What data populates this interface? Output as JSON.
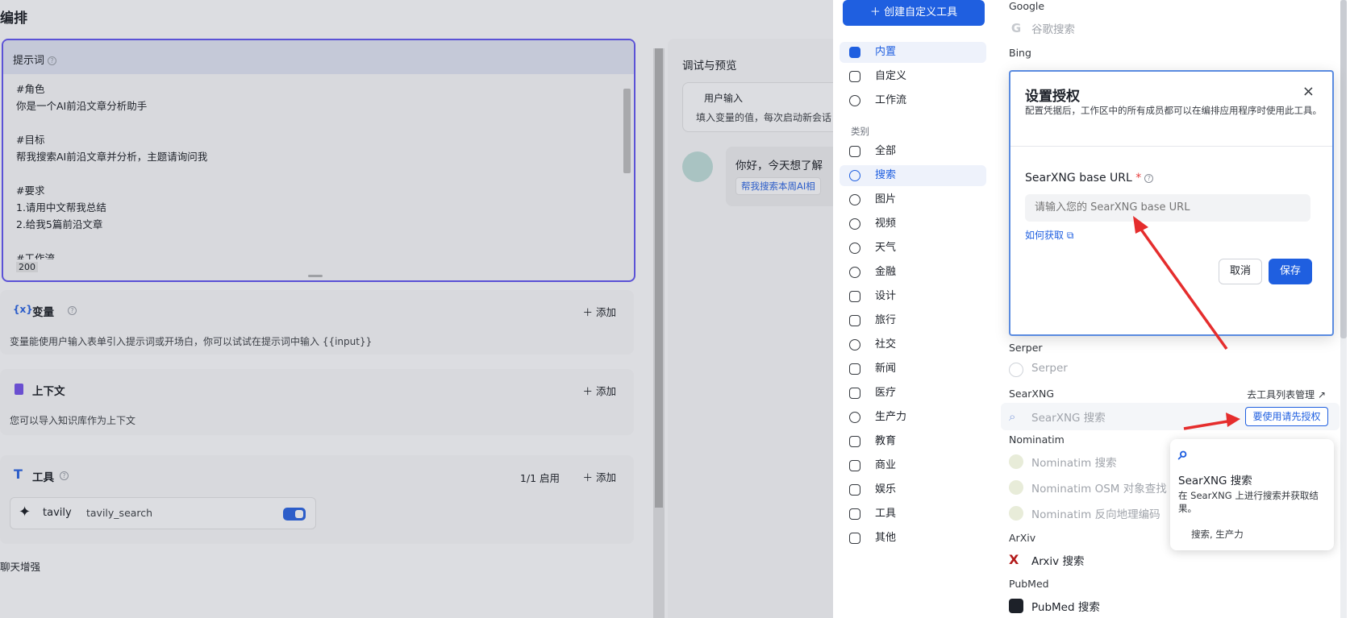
{
  "editor": {
    "title": "编排",
    "prompt": {
      "label": "提示词",
      "text": "#角色\n你是一个AI前沿文章分析助手\n\n#目标\n帮我搜索AI前沿文章并分析，主题请询问我\n\n#要求\n1.请用中文帮我总结\n2.给我5篇前沿文章\n\n#工作流",
      "count": "200"
    },
    "variables": {
      "title": "变量",
      "add": "添加",
      "desc": "变量能使用户输入表单引入提示词或开场白，你可以试试在提示词中输入 {{input}}"
    },
    "context": {
      "title": "上下文",
      "add": "添加",
      "desc": "您可以导入知识库作为上下文"
    },
    "tools": {
      "title": "工具",
      "status": "1/1 启用",
      "add": "添加",
      "item_name": "tavily",
      "item_tool": "tavily_search"
    },
    "chat_enhance": "聊天增强"
  },
  "debug": {
    "title": "调试与预览",
    "user_input": "用户输入",
    "user_input_desc": "填入变量的值，每次启动新会话",
    "greeting": "你好，今天想了解",
    "suggestion": "帮我搜索本周AI相"
  },
  "selector": {
    "create_button": "创建自定义工具",
    "nav": [
      "内置",
      "自定义",
      "工作流"
    ],
    "category_label": "类别",
    "categories": [
      "全部",
      "搜索",
      "图片",
      "视频",
      "天气",
      "金融",
      "设计",
      "旅行",
      "社交",
      "新闻",
      "医疗",
      "生产力",
      "教育",
      "商业",
      "娱乐",
      "工具",
      "其他"
    ],
    "active_nav": "内置",
    "active_category": "搜索"
  },
  "toollist": {
    "google": {
      "provider": "Google",
      "tool": "谷歌搜索"
    },
    "bing": {
      "provider": "Bing"
    },
    "serper": {
      "provider": "Serper",
      "tool": "Serper"
    },
    "searxng": {
      "provider": "SearXNG",
      "tool": "SearXNG 搜索",
      "manage": "去工具列表管理 ↗",
      "auth_button": "要使用请先授权"
    },
    "nominatim": {
      "provider": "Nominatim",
      "tools": [
        "Nominatim 搜索",
        "Nominatim OSM 对象查找",
        "Nominatim 反向地理编码"
      ]
    },
    "arxiv": {
      "provider": "ArXiv",
      "tool": "Arxiv 搜索"
    },
    "pubmed": {
      "provider": "PubMed",
      "tool": "PubMed 搜索"
    }
  },
  "modal": {
    "title": "设置授权",
    "desc": "配置凭据后，工作区中的所有成员都可以在编排应用程序时使用此工具。",
    "field_label": "SearXNG base URL",
    "field_required": "*",
    "field_placeholder": "请输入您的 SearXNG base URL",
    "help_link": "如何获取",
    "cancel": "取消",
    "save": "保存"
  },
  "tooltip": {
    "title": "SearXNG 搜索",
    "desc": "在 SearXNG 上进行搜索并获取结果。",
    "tags": "搜索, 生产力"
  },
  "colors": {
    "accent": "#1f5fe0",
    "annotation_arrow": "#e52d2d",
    "prompt_border": "#5b52d6"
  }
}
